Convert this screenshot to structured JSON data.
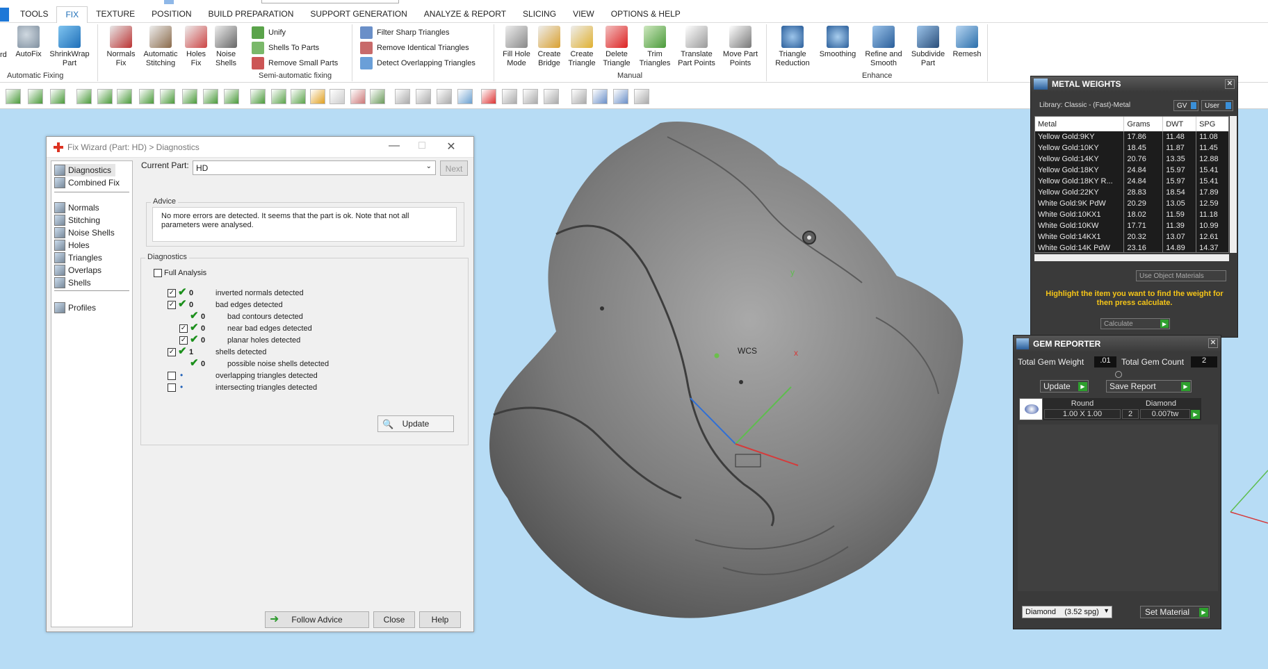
{
  "menu": {
    "tabs": [
      "TOOLS",
      "FIX",
      "TEXTURE",
      "POSITION",
      "BUILD PREPARATION",
      "SUPPORT GENERATION",
      "ANALYZE & REPORT",
      "SLICING",
      "VIEW",
      "OPTIONS & HELP"
    ],
    "active": "FIX"
  },
  "ribbon": {
    "cut_left": "rd",
    "autofix": "AutoFix",
    "shrinkwrap": "ShrinkWrap\nPart",
    "normals": "Normals\nFix",
    "auto_stitch": "Automatic\nStitching",
    "holes": "Holes\nFix",
    "noise": "Noise\nShells",
    "unify": "Unify",
    "shells_to_parts": "Shells To Parts",
    "remove_small": "Remove Small Parts",
    "filter_sharp": "Filter Sharp Triangles",
    "remove_identical": "Remove Identical Triangles",
    "detect_overlap": "Detect Overlapping Triangles",
    "fill_hole": "Fill Hole\nMode",
    "create_bridge": "Create\nBridge",
    "create_triangle": "Create\nTriangle",
    "delete_triangle": "Delete\nTriangle",
    "trim_triangles": "Trim\nTriangles",
    "translate_points": "Translate\nPart Points",
    "move_points": "Move Part\nPoints",
    "tri_reduction": "Triangle\nReduction",
    "smoothing": "Smoothing",
    "refine": "Refine and\nSmooth",
    "subdivide": "Subdivide\nPart",
    "remesh": "Remesh",
    "groups": {
      "automatic": "Automatic Fixing",
      "semi": "Semi-automatic fixing",
      "manual": "Manual",
      "enhance": "Enhance"
    }
  },
  "fixwizard": {
    "title": "Fix Wizard (Part: HD) > Diagnostics",
    "nav": [
      "Diagnostics",
      "Combined Fix",
      "Normals",
      "Stitching",
      "Noise Shells",
      "Holes",
      "Triangles",
      "Overlaps",
      "Shells",
      "Profiles"
    ],
    "current_part_label": "Current Part:",
    "current_part": "HD",
    "next": "Next",
    "advice_label": "Advice",
    "advice_text": "No more errors are detected. It seems that the part is ok. Note that not all parameters were analysed.",
    "diagnostics_label": "Diagnostics",
    "full_analysis": "Full Analysis",
    "rows": [
      {
        "count": "0",
        "label": "inverted normals detected"
      },
      {
        "count": "0",
        "label": "bad edges detected"
      },
      {
        "count": "0",
        "label": "bad contours detected"
      },
      {
        "count": "0",
        "label": "near bad edges detected"
      },
      {
        "count": "0",
        "label": "planar holes detected"
      },
      {
        "count": "1",
        "label": "shells detected"
      },
      {
        "count": "0",
        "label": "possible noise shells detected"
      },
      {
        "count": "",
        "label": "overlapping triangles detected"
      },
      {
        "count": "",
        "label": "intersecting triangles detected"
      }
    ],
    "update": "Update",
    "follow_advice": "Follow Advice",
    "close": "Close",
    "help": "Help"
  },
  "metal_weights": {
    "title": "METAL WEIGHTS",
    "library": "Library: Classic - (Fast)-Metal",
    "gv": "GV",
    "user": "User",
    "columns": [
      "Metal",
      "Grams",
      "DWT",
      "SPG"
    ],
    "rows": [
      [
        "Yellow Gold:9KY",
        "17.86",
        "11.48",
        "11.08"
      ],
      [
        "Yellow Gold:10KY",
        "18.45",
        "11.87",
        "11.45"
      ],
      [
        "Yellow Gold:14KY",
        "20.76",
        "13.35",
        "12.88"
      ],
      [
        "Yellow Gold:18KY",
        "24.84",
        "15.97",
        "15.41"
      ],
      [
        "Yellow Gold:18KY R...",
        "24.84",
        "15.97",
        "15.41"
      ],
      [
        "Yellow Gold:22KY",
        "28.83",
        "18.54",
        "17.89"
      ],
      [
        "White Gold:9K PdW",
        "20.29",
        "13.05",
        "12.59"
      ],
      [
        "White Gold:10KX1",
        "18.02",
        "11.59",
        "11.18"
      ],
      [
        "White Gold:10KW",
        "17.71",
        "11.39",
        "10.99"
      ],
      [
        "White Gold:14KX1",
        "20.32",
        "13.07",
        "12.61"
      ],
      [
        "White Gold:14K PdW",
        "23.16",
        "14.89",
        "14.37"
      ]
    ],
    "use_object_materials": "Use Object Materials",
    "hint": "Highlight the item you want to find the weight for then press calculate.",
    "calculate": "Calculate"
  },
  "gem_reporter": {
    "title": "GEM REPORTER",
    "total_weight_label": "Total Gem Weight",
    "total_weight": ".01",
    "total_count_label": "Total Gem Count",
    "total_count": "2",
    "update": "Update",
    "save_report": "Save Report",
    "gem_shape": "Round",
    "gem_size": "1.00 X 1.00",
    "gem_type": "Diamond",
    "gem_qty": "2",
    "gem_weight": "0.007tw",
    "material": "Diamond    (3.52 spg)",
    "set_material": "Set Material"
  },
  "viewport": {
    "wcs": "WCS",
    "x": "x",
    "y": "y"
  }
}
